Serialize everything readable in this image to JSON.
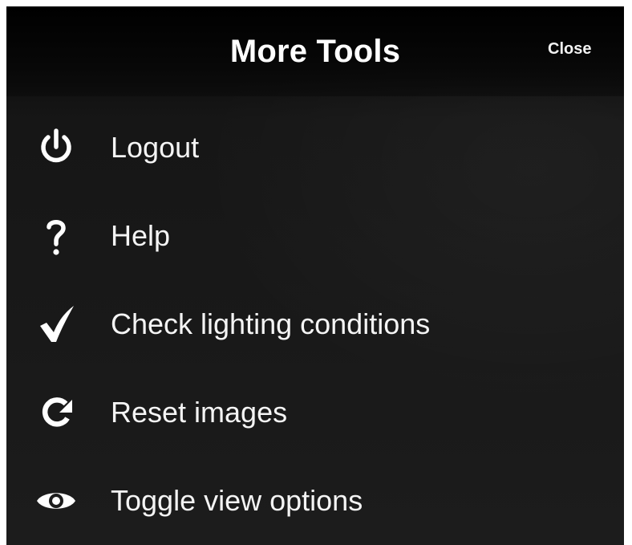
{
  "header": {
    "title": "More Tools",
    "close_label": "Close"
  },
  "menu": {
    "items": [
      {
        "label": "Logout",
        "icon": "power-icon"
      },
      {
        "label": "Help",
        "icon": "question-icon"
      },
      {
        "label": "Check lighting conditions",
        "icon": "checkmark-icon"
      },
      {
        "label": "Reset images",
        "icon": "refresh-icon"
      },
      {
        "label": "Toggle view options",
        "icon": "eye-icon"
      }
    ]
  },
  "colors": {
    "background": "#1c1c1c",
    "header_background": "#000000",
    "text": "#ffffff",
    "frame": "#ffffff"
  }
}
